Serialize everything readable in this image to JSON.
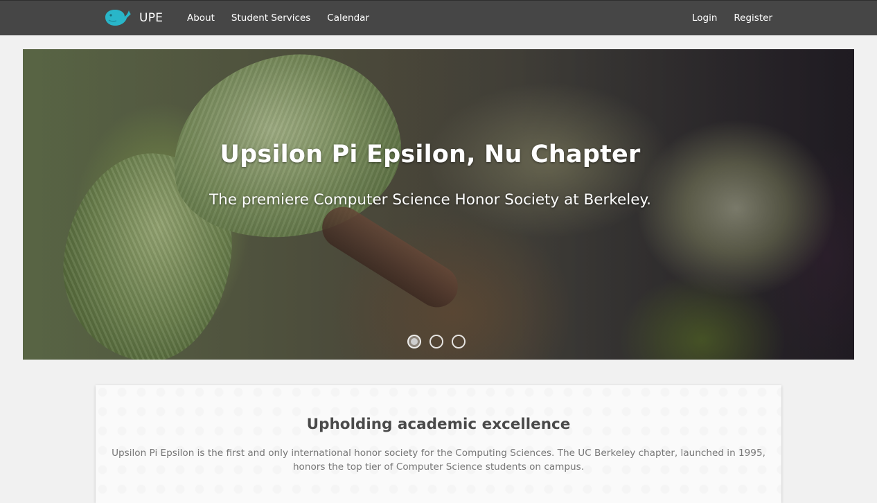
{
  "navbar": {
    "brand": {
      "icon": "whale-icon",
      "label": "UPE",
      "color": "#29b6c9"
    },
    "left_links": [
      "About",
      "Student Services",
      "Calendar"
    ],
    "right_links": [
      "Login",
      "Register"
    ],
    "background": "#464646"
  },
  "hero": {
    "title": "Upsilon Pi Epsilon, Nu Chapter",
    "subtitle": "The premiere Computer Science Honor Society at Berkeley.",
    "slides_total": 3,
    "active_slide": 1
  },
  "intro": {
    "heading": "Upholding academic excellence",
    "body": "Upsilon Pi Epsilon is the first and only international honor society for the Computing Sciences. The UC Berkeley chapter, launched in 1995, honors the top tier of Computer Science students on campus."
  }
}
